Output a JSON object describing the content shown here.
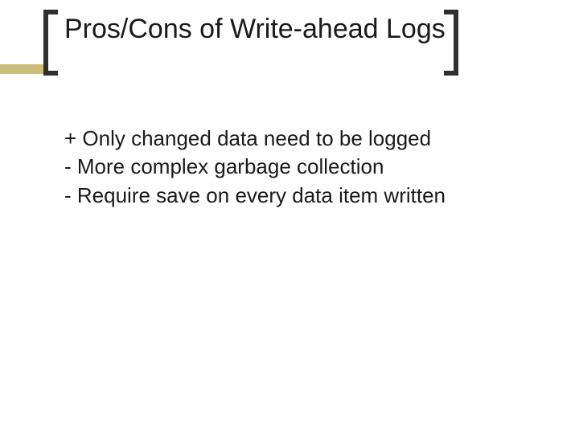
{
  "title": "Pros/Cons of Write-ahead Logs",
  "items": [
    "+ Only changed data need to be logged",
    "- More complex garbage collection",
    "- Require save on every data item written"
  ]
}
